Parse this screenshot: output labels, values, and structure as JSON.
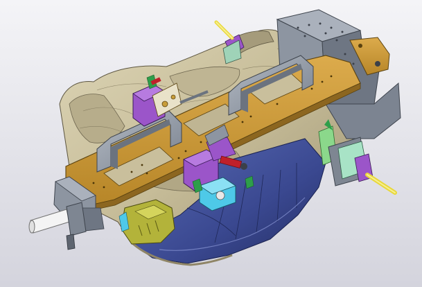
{
  "viewport": {
    "background_top": "#f4f4f7",
    "background_bottom": "#d4d4dd"
  },
  "model": {
    "subject": "cad-assembly-welding-fixture",
    "colors": {
      "base_plate": "#c99a3c",
      "base_plate_dark": "#8c6620",
      "bracket_gray": "#8f97a3",
      "bracket_gray_dark": "#5e6570",
      "bracket_gray_light": "#b8bfc9",
      "clamp_purple": "#9b55c9",
      "clamp_purple_dark": "#5f2f86",
      "clamp_cyan": "#4ec9e8",
      "clamp_green": "#8bd88b",
      "clamp_olive": "#b3b33a",
      "pin_yellow": "#f2e85a",
      "pin_white": "#f4f4f4",
      "panel_navy": "#2e3b7a",
      "panel_blue": "#4d5fa8",
      "panel_tan": "#c9bf9c",
      "panel_tan_dark": "#8f8566",
      "spring_red": "#c0202a"
    }
  }
}
